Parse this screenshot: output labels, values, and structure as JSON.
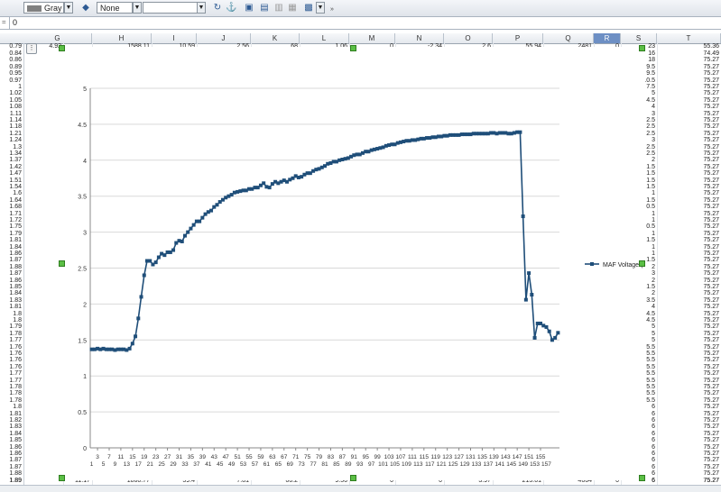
{
  "toolbar": {
    "line_color_value": "Gray",
    "line_style_value": "None",
    "blank_select_value": ""
  },
  "formula_bar": {
    "value": "0"
  },
  "columns": [
    "G",
    "H",
    "I",
    "J",
    "K",
    "L",
    "M",
    "N",
    "O",
    "P",
    "Q",
    "R",
    "S",
    "T"
  ],
  "selected_column": "R",
  "top_row": {
    "A": "0.79",
    "F": "4.92",
    "H": "1588.11",
    "I": "10.59",
    "J": "2.56",
    "K": "68",
    "L": "1.06",
    "M": "0",
    "N": "-2.34",
    "O": "2.6",
    "P": "55.94",
    "Q": "2481",
    "R": "0",
    "S": "23",
    "T": "55.36"
  },
  "bottom_row": {
    "A": "1.89",
    "G": "11.17",
    "H": "1860.77",
    "I": "59.4",
    "J": "7.81",
    "K": "66.2",
    "L": "9.56",
    "M": "0",
    "N": "0",
    "O": "3.97",
    "P": "213.01",
    "Q": "4664",
    "R": "0",
    "S": "6",
    "T": "75.27"
  },
  "left_column_values": [
    "0.84",
    "0.86",
    "0.89",
    "0.95",
    "0.97",
    "1",
    "1.02",
    "1.05",
    "1.08",
    "1.11",
    "1.14",
    "1.18",
    "1.21",
    "1.24",
    "1.3",
    "1.34",
    "1.37",
    "1.42",
    "1.47",
    "1.51",
    "1.54",
    "1.6",
    "1.64",
    "1.68",
    "1.71",
    "1.72",
    "1.75",
    "1.79",
    "1.81",
    "1.84",
    "1.86",
    "1.87",
    "1.88",
    "1.87",
    "1.86",
    "1.85",
    "1.84",
    "1.83",
    "1.81",
    "1.8",
    "1.8",
    "1.79",
    "1.78",
    "1.77",
    "1.76",
    "1.76",
    "1.76",
    "1.76",
    "1.77",
    "1.77",
    "1.78",
    "1.78",
    "1.78",
    "1.8",
    "1.81",
    "1.82",
    "1.83",
    "1.84",
    "1.85",
    "1.86",
    "1.86",
    "1.87",
    "1.87",
    "1.88",
    "1.89"
  ],
  "col_s_values": [
    "16",
    "18",
    "9.5",
    "9.5",
    "10.5",
    "7.5",
    "5",
    "4.5",
    "4",
    "3",
    "2.5",
    "2.5",
    "2.5",
    "3",
    "2.5",
    "2.5",
    "2",
    "1.5",
    "1.5",
    "1.5",
    "1.5",
    "1",
    "1.5",
    "0.5",
    "1",
    "1",
    "0.5",
    "1",
    "1.5",
    "1",
    "1",
    "1.5",
    "2",
    "3",
    "2",
    "1.5",
    "2",
    "3.5",
    "4",
    "4.5",
    "4.5",
    "5",
    "5",
    "5",
    "5.5",
    "5.5",
    "5.5",
    "5.5",
    "5.5",
    "5.5",
    "5.5",
    "5.5",
    "5.5",
    "6",
    "6",
    "6",
    "6",
    "6",
    "6",
    "6",
    "6",
    "6",
    "6",
    "6",
    "6"
  ],
  "col_t_values": [
    "74.49",
    "75.27",
    "75.27",
    "75.27",
    "75.27",
    "75.27",
    "75.27",
    "75.27",
    "75.27",
    "75.27",
    "75.27",
    "75.27",
    "75.27",
    "75.27",
    "75.27",
    "75.27",
    "75.27",
    "75.27",
    "75.27",
    "75.27",
    "75.27",
    "75.27",
    "75.27",
    "75.27",
    "75.27",
    "75.27",
    "75.27",
    "75.27",
    "75.27",
    "75.27",
    "75.27",
    "75.27",
    "75.27",
    "75.27",
    "75.27",
    "75.27",
    "75.27",
    "75.27",
    "75.27",
    "75.27",
    "75.27",
    "75.27",
    "75.27",
    "75.27",
    "75.27",
    "75.27",
    "75.27",
    "75.27",
    "75.27",
    "75.27",
    "75.27",
    "75.27",
    "75.27",
    "75.27",
    "75.27",
    "75.27",
    "75.27",
    "75.27",
    "75.27",
    "75.27",
    "75.27",
    "75.27",
    "75.27",
    "75.27",
    "75.27"
  ],
  "colors": {
    "series": "#1f4e79",
    "grid": "#d9d9d9",
    "selected_col": "#6d8fc4",
    "handle": "#5bbf45"
  },
  "chart_data": {
    "type": "line",
    "title": "",
    "xlabel": "",
    "ylabel": "",
    "ylim": [
      0,
      5
    ],
    "yticks": [
      0,
      0.5,
      1,
      1.5,
      2,
      2.5,
      3,
      3.5,
      4,
      4.5,
      5
    ],
    "x_tick_labels_row1": [
      "3",
      "7",
      "11",
      "15",
      "19",
      "23",
      "27",
      "31",
      "35",
      "39",
      "43",
      "47",
      "51",
      "55",
      "59",
      "63",
      "67",
      "71",
      "75",
      "79",
      "83",
      "87",
      "91",
      "95",
      "99",
      "103",
      "107",
      "111",
      "115",
      "119",
      "123",
      "127",
      "131",
      "135",
      "139",
      "143",
      "147",
      "151",
      "155"
    ],
    "x_tick_labels_row2": [
      "1",
      "5",
      "9",
      "13",
      "17",
      "21",
      "25",
      "29",
      "33",
      "37",
      "41",
      "45",
      "49",
      "53",
      "57",
      "61",
      "65",
      "69",
      "73",
      "77",
      "81",
      "85",
      "89",
      "93",
      "97",
      "101",
      "105",
      "109",
      "113",
      "117",
      "121",
      "125",
      "129",
      "133",
      "137",
      "141",
      "145",
      "149",
      "153",
      "157"
    ],
    "grid": true,
    "legend": "right",
    "series": [
      {
        "name": "MAF Voltage (V)",
        "marker": "square",
        "values": [
          1.37,
          1.37,
          1.38,
          1.37,
          1.38,
          1.37,
          1.37,
          1.37,
          1.36,
          1.37,
          1.37,
          1.37,
          1.36,
          1.38,
          1.45,
          1.55,
          1.8,
          2.1,
          2.4,
          2.6,
          2.6,
          2.55,
          2.58,
          2.65,
          2.7,
          2.68,
          2.72,
          2.72,
          2.75,
          2.85,
          2.88,
          2.87,
          2.95,
          3.0,
          3.05,
          3.1,
          3.15,
          3.15,
          3.2,
          3.25,
          3.28,
          3.3,
          3.35,
          3.38,
          3.42,
          3.45,
          3.48,
          3.5,
          3.52,
          3.55,
          3.56,
          3.57,
          3.58,
          3.58,
          3.6,
          3.6,
          3.62,
          3.62,
          3.65,
          3.68,
          3.63,
          3.62,
          3.67,
          3.7,
          3.68,
          3.7,
          3.72,
          3.7,
          3.73,
          3.75,
          3.78,
          3.76,
          3.77,
          3.8,
          3.82,
          3.82,
          3.85,
          3.87,
          3.88,
          3.9,
          3.92,
          3.95,
          3.96,
          3.98,
          3.98,
          4.0,
          4.01,
          4.02,
          4.03,
          4.05,
          4.07,
          4.08,
          4.08,
          4.1,
          4.12,
          4.12,
          4.14,
          4.15,
          4.16,
          4.17,
          4.18,
          4.2,
          4.21,
          4.22,
          4.22,
          4.24,
          4.25,
          4.26,
          4.27,
          4.27,
          4.28,
          4.28,
          4.29,
          4.3,
          4.3,
          4.31,
          4.31,
          4.32,
          4.32,
          4.33,
          4.33,
          4.34,
          4.34,
          4.35,
          4.35,
          4.35,
          4.35,
          4.36,
          4.36,
          4.36,
          4.36,
          4.37,
          4.37,
          4.37,
          4.37,
          4.37,
          4.37,
          4.38,
          4.38,
          4.37,
          4.38,
          4.38,
          4.38,
          4.37,
          4.37,
          4.38,
          4.39,
          4.39,
          3.22,
          2.06,
          2.43,
          2.13,
          1.53,
          1.73,
          1.73,
          1.7,
          1.68,
          1.62,
          1.5,
          1.53,
          1.6
        ]
      }
    ]
  }
}
